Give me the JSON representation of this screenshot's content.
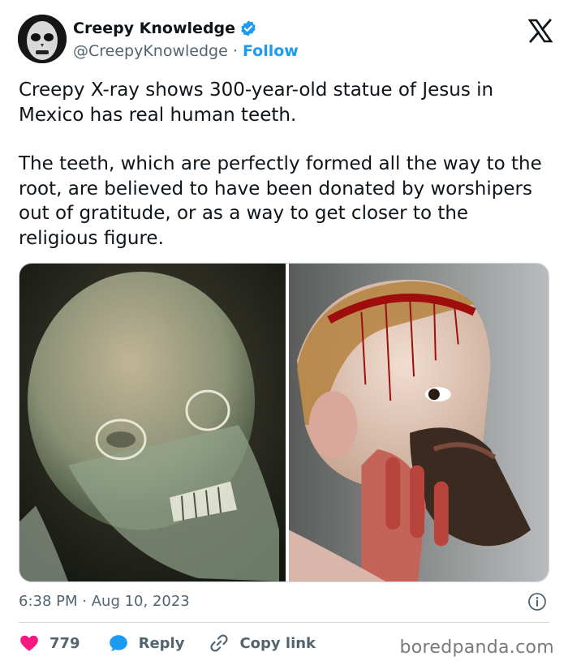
{
  "author": {
    "display_name": "Creepy Knowledge",
    "handle": "@CreepyKnowledge",
    "separator": "·",
    "follow_label": "Follow",
    "avatar_icon": "skull-face-avatar",
    "verified_icon": "verified-badge-icon"
  },
  "platform_logo": "x-logo-icon",
  "tweet": {
    "paragraphs": [
      "Creepy X-ray shows 300-year-old statue of Jesus in Mexico has real human teeth.",
      "The teeth, which are perfectly formed all the way to the root, are believed to have been donated by worshipers out of gratitude, or as a way to get closer to the religious figure."
    ]
  },
  "media": {
    "images": [
      {
        "name": "xray-statue-head"
      },
      {
        "name": "painted-statue-head"
      }
    ]
  },
  "meta": {
    "time": "6:38 PM",
    "separator": "·",
    "date": "Aug 10, 2023"
  },
  "actions": {
    "like_count": "779",
    "reply_label": "Reply",
    "copy_link_label": "Copy link"
  },
  "watermark": "boredpanda.com",
  "colors": {
    "accent": "#1d9bf0",
    "like": "#f91880",
    "text": "#0f1419",
    "muted": "#536471"
  }
}
